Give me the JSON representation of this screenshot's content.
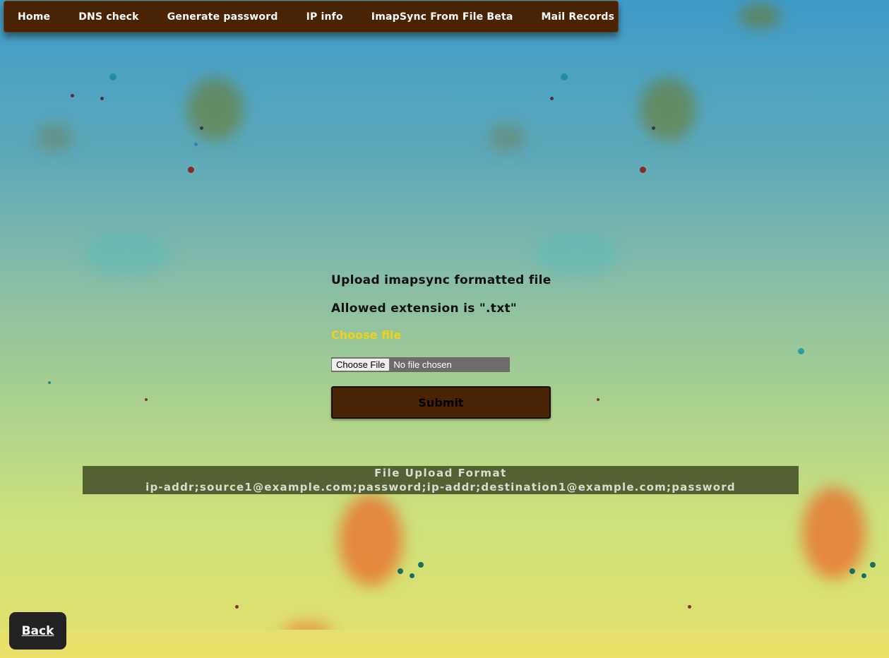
{
  "nav": {
    "items": [
      {
        "label": "Home"
      },
      {
        "label": "DNS check"
      },
      {
        "label": "Generate password"
      },
      {
        "label": "IP info"
      },
      {
        "label": "ImapSync From File Beta"
      },
      {
        "label": "Mail Records"
      }
    ]
  },
  "form": {
    "heading": "Upload imapsync formatted file",
    "extension_note": "Allowed extension is \".txt\"",
    "choose_label": "Choose file",
    "file_button": "Choose File",
    "file_status": "No file chosen",
    "submit_label": "Submit"
  },
  "format_box": {
    "title": "File Upload Format",
    "value": "ip-addr;source1@example.com;password;ip-addr;destination1@example.com;password"
  },
  "back": {
    "label": "Back"
  },
  "colors": {
    "nav_bg": "#4a2304",
    "accent_label": "#f0d21a",
    "format_bg": "#46502899",
    "back_bg": "#222222"
  }
}
